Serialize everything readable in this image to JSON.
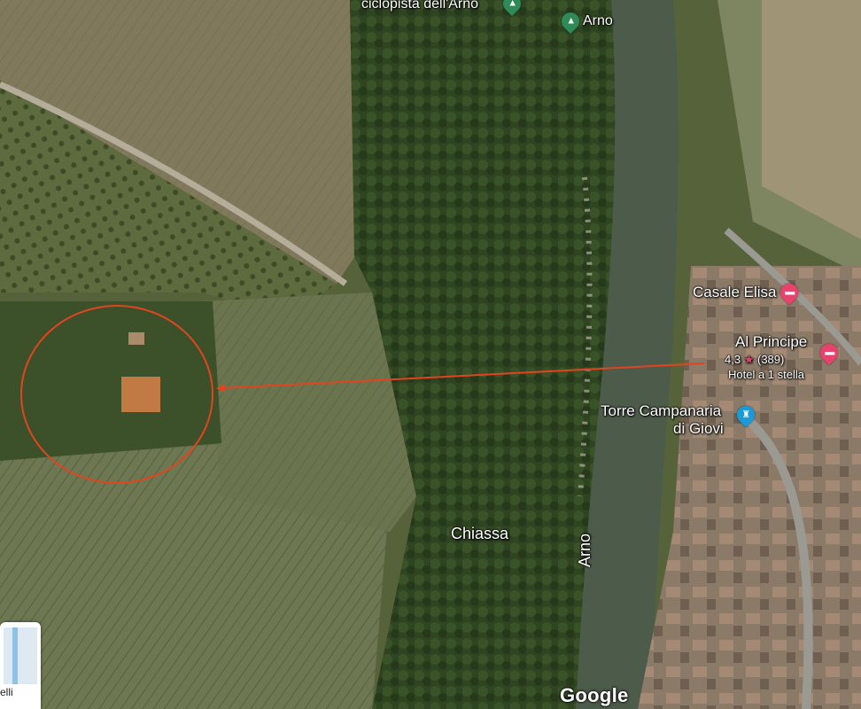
{
  "map": {
    "labels": {
      "cycle_path": "ciclopista dell'Arno",
      "arno_top": "Arno",
      "chiassa": "Chiassa",
      "arno_river": "Arno"
    },
    "pois": [
      {
        "name": "Casale Elisa",
        "icon": "hotel-icon"
      },
      {
        "name": "Al Principe",
        "rating": "4,3",
        "reviews": "(389)",
        "category": "Hotel a 1 stella",
        "icon": "hotel-icon"
      },
      {
        "name_line1": "Torre Campanaria",
        "name_line2": "di Giovi",
        "icon": "tower-icon"
      }
    ],
    "annotation": {
      "color": "#e0451f"
    },
    "thumbnail_text": "elli",
    "logo": "Google"
  }
}
